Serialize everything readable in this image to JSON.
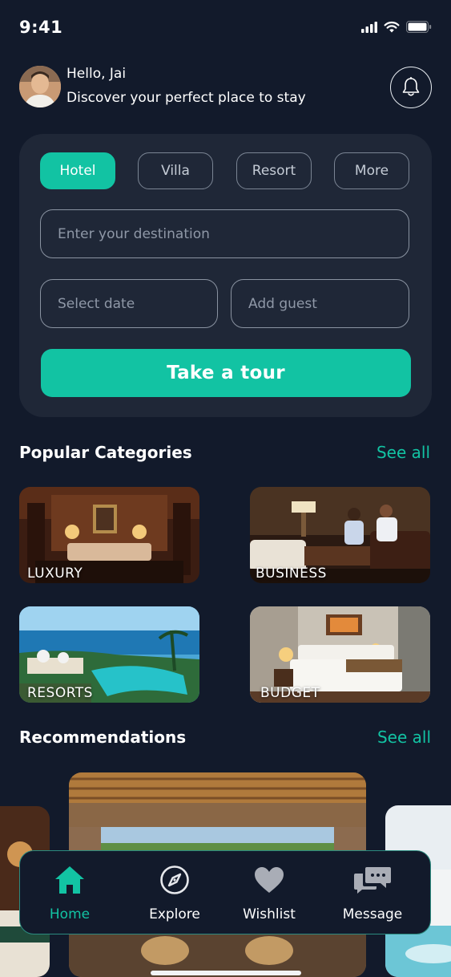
{
  "status_bar": {
    "time": "9:41"
  },
  "header": {
    "greeting": "Hello, Jai",
    "tagline": "Discover your perfect place to stay"
  },
  "search": {
    "tabs": [
      {
        "label": "Hotel",
        "active": true
      },
      {
        "label": "Villa",
        "active": false
      },
      {
        "label": "Resort",
        "active": false
      },
      {
        "label": "More",
        "active": false
      }
    ],
    "destination_placeholder": "Enter your destination",
    "date_placeholder": "Select date",
    "guest_placeholder": "Add guest",
    "cta_label": "Take a tour"
  },
  "categories": {
    "title": "Popular Categories",
    "see_all": "See all",
    "items": [
      {
        "label": "LUXURY"
      },
      {
        "label": "BUSINESS"
      },
      {
        "label": "RESORTS"
      },
      {
        "label": "BUDGET"
      }
    ]
  },
  "recommendations": {
    "title": "Recommendations",
    "see_all": "See all"
  },
  "bottom_nav": {
    "items": [
      {
        "label": "Home",
        "icon": "home-icon",
        "active": true
      },
      {
        "label": "Explore",
        "icon": "compass-icon",
        "active": false
      },
      {
        "label": "Wishlist",
        "icon": "heart-icon",
        "active": false
      },
      {
        "label": "Message",
        "icon": "chat-icon",
        "active": false
      }
    ]
  },
  "colors": {
    "background": "#121a2b",
    "card": "#1f2737",
    "accent": "#12c3a3"
  }
}
